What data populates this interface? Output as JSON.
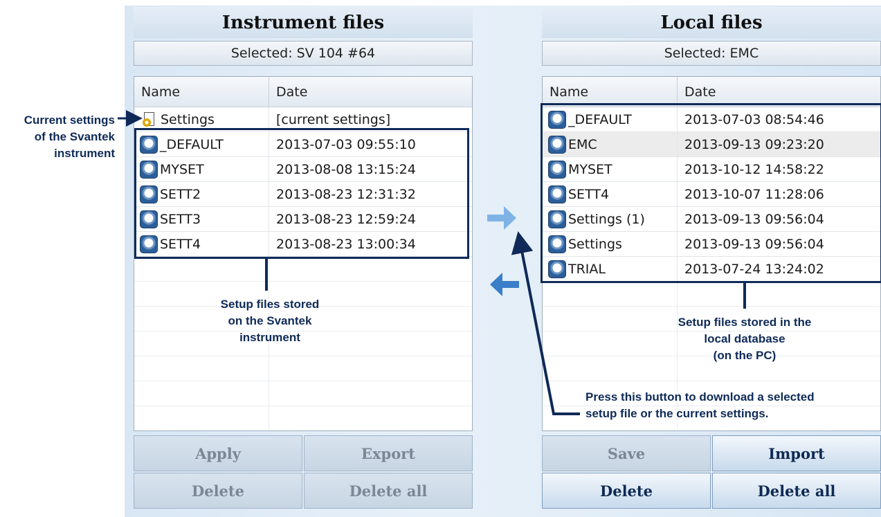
{
  "instrument": {
    "title": "Instrument files",
    "selected": "Selected: SV 104 #64",
    "col_name": "Name",
    "col_date": "Date",
    "rows": [
      {
        "name": "Settings",
        "date": "[current settings]",
        "icon": "settings-file-icon"
      },
      {
        "name": "_DEFAULT",
        "date": "2013-07-03 09:55:10",
        "icon": "setup-file-icon"
      },
      {
        "name": "MYSET",
        "date": "2013-08-08 13:15:24",
        "icon": "setup-file-icon"
      },
      {
        "name": "SETT2",
        "date": "2013-08-23 12:31:32",
        "icon": "setup-file-icon"
      },
      {
        "name": "SETT3",
        "date": "2013-08-23 12:59:24",
        "icon": "setup-file-icon"
      },
      {
        "name": "SETT4",
        "date": "2013-08-23 13:00:34",
        "icon": "setup-file-icon"
      }
    ],
    "buttons": {
      "apply": "Apply",
      "export": "Export",
      "delete": "Delete",
      "delete_all": "Delete all"
    }
  },
  "local": {
    "title": "Local files",
    "selected": "Selected: EMC",
    "col_name": "Name",
    "col_date": "Date",
    "rows": [
      {
        "name": "_DEFAULT",
        "date": "2013-07-03 08:54:46",
        "icon": "setup-file-icon"
      },
      {
        "name": "EMC",
        "date": "2013-09-13 09:23:20",
        "icon": "setup-file-icon",
        "selected": true
      },
      {
        "name": "MYSET",
        "date": "2013-10-12 14:58:22",
        "icon": "setup-file-icon"
      },
      {
        "name": "SETT4",
        "date": "2013-10-07 11:28:06",
        "icon": "setup-file-icon"
      },
      {
        "name": "Settings (1)",
        "date": "2013-09-13 09:56:04",
        "icon": "setup-file-icon"
      },
      {
        "name": "Settings",
        "date": "2013-09-13 09:56:04",
        "icon": "setup-file-icon"
      },
      {
        "name": "TRIAL",
        "date": "2013-07-24 13:24:02",
        "icon": "setup-file-icon"
      }
    ],
    "buttons": {
      "save": "Save",
      "import": "Import",
      "delete": "Delete",
      "delete_all": "Delete all"
    }
  },
  "transfer": {
    "download_icon": "arrow-right-icon",
    "upload_icon": "arrow-left-icon"
  },
  "annotations": {
    "current_settings": [
      "Current settings",
      "of the Svantek",
      "instrument"
    ],
    "instrument_files": [
      "Setup files stored",
      "on the Svantek",
      "instrument"
    ],
    "local_files": [
      "Setup files stored in the",
      "local database",
      "(on the PC)"
    ],
    "download_hint": [
      "Press this button to download a selected",
      "setup file or the current settings."
    ]
  },
  "colors": {
    "annotation": "#0f2a58",
    "arrow_light": "#7fb3e6",
    "arrow_dark": "#3a7fc8"
  }
}
